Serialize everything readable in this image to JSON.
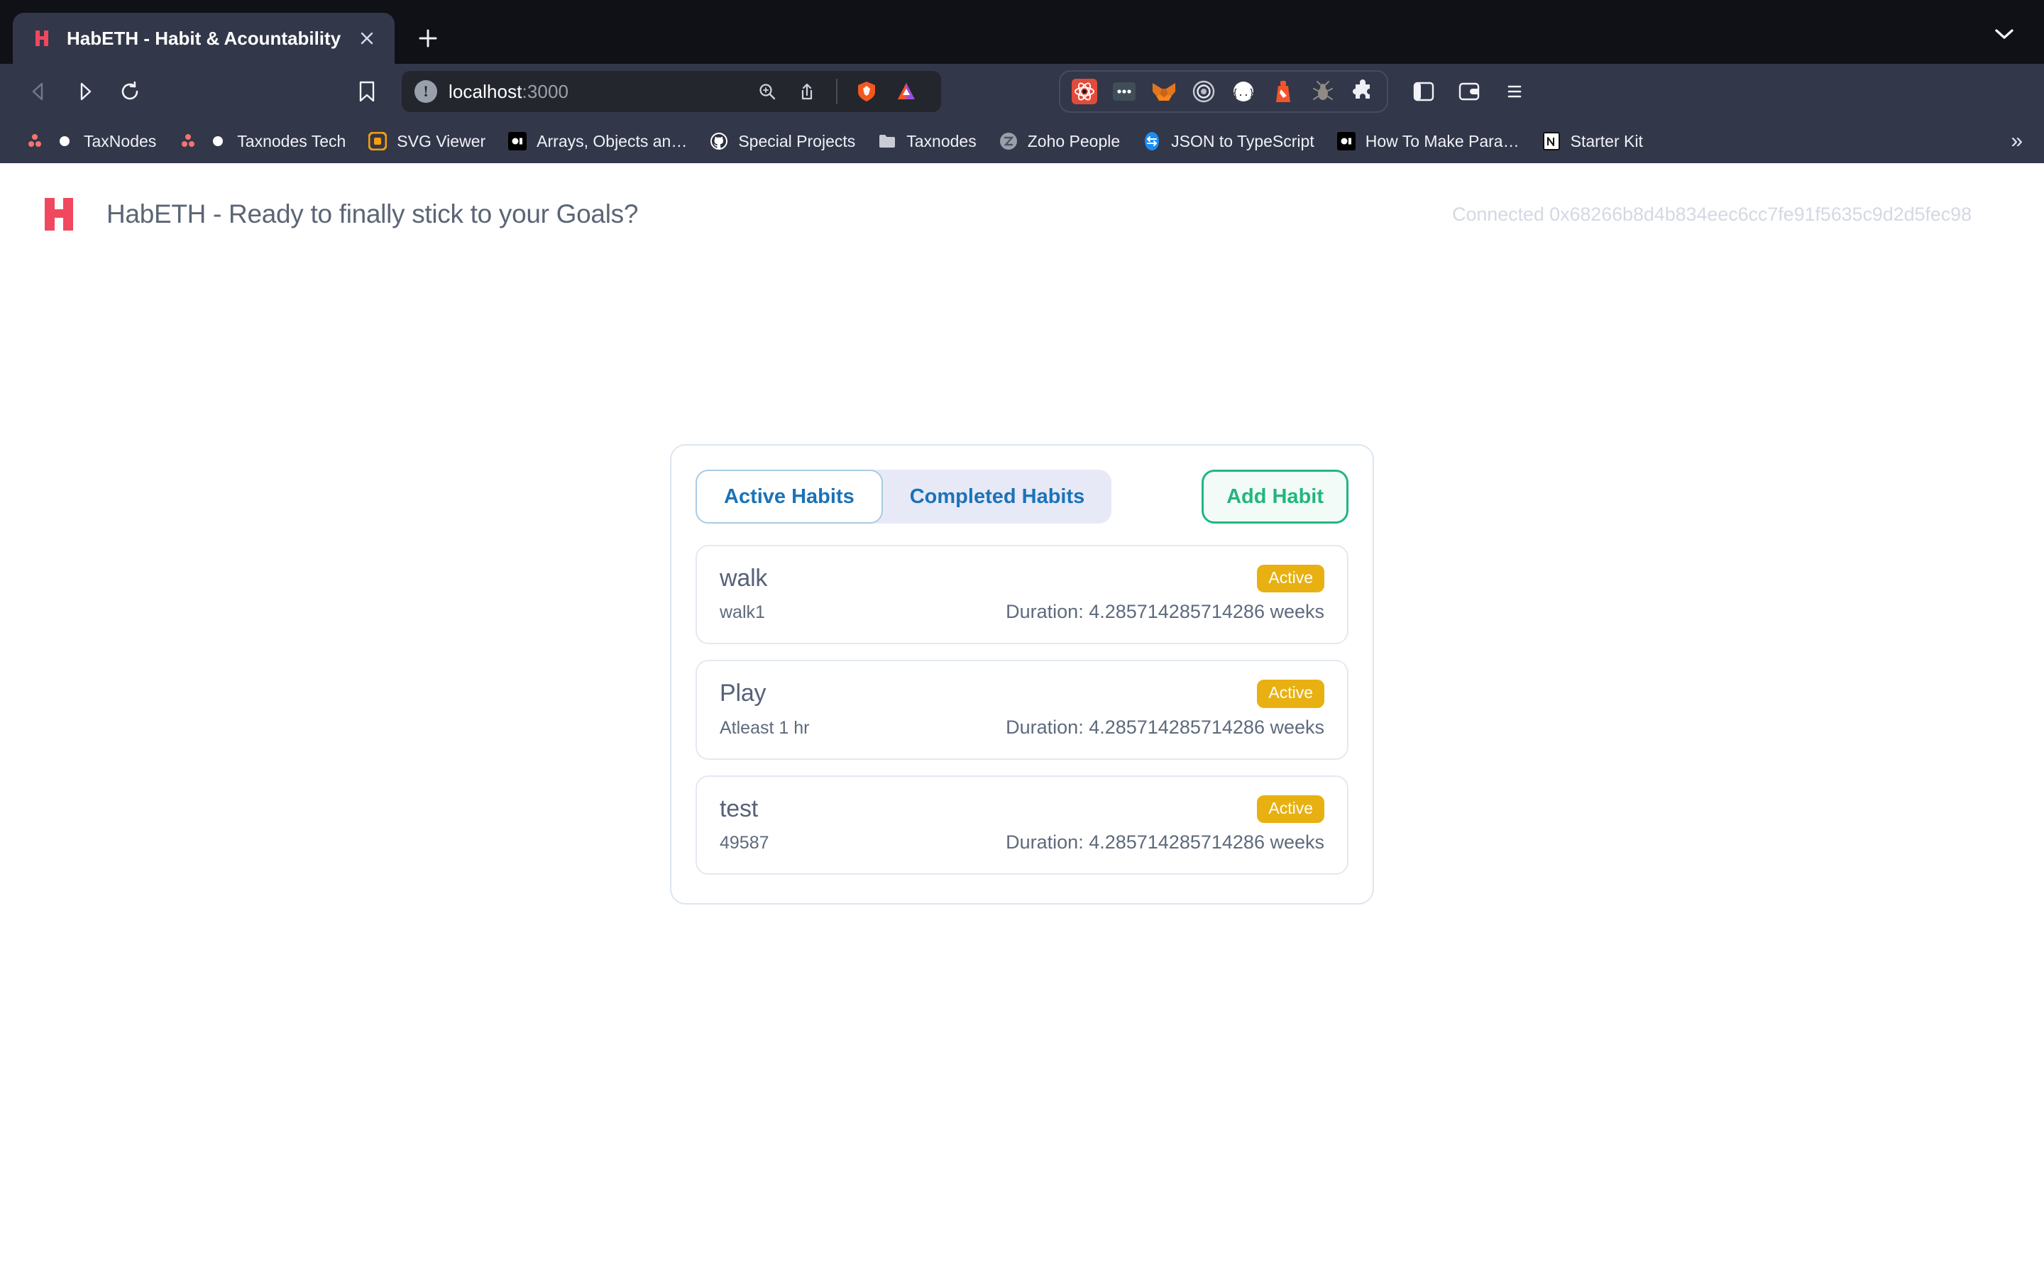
{
  "browser": {
    "tab": {
      "title": "HabETH - Habit & Acountability",
      "close_label": "×",
      "favicon_name": "habeth-favicon"
    },
    "new_tab_label": "+",
    "tab_search_name": "tab-search-chevron",
    "nav": {
      "back_label": "Back",
      "forward_label": "Forward",
      "reload_label": "Reload"
    },
    "url": {
      "host": "localhost",
      "port": ":3000",
      "security_label": "!",
      "security_state": "Not secure"
    },
    "url_actions": [
      "zoom-in-icon",
      "share-icon",
      "brave-shields-icon",
      "bat-rewards-icon"
    ],
    "extensions": [
      {
        "name": "react-devtools-extension",
        "color": "#e24b3a"
      },
      {
        "name": "dots-extension",
        "color": "#3f4e57"
      },
      {
        "name": "metamask-extension",
        "color": "#e2761b"
      },
      {
        "name": "target-extension",
        "color": "#b8bcc4"
      },
      {
        "name": "json-viewer-extension",
        "color": "#ffffff"
      },
      {
        "name": "lighthouse-extension",
        "color": "#f2552c"
      },
      {
        "name": "bug-extension",
        "color": "#8f8a84"
      },
      {
        "name": "puzzle-extension",
        "color": "#eef0f6"
      }
    ],
    "right_icons": [
      "sidebar-icon",
      "wallet-icon",
      "browser-menu-icon"
    ],
    "bookmarks": [
      {
        "label": "TaxNodes",
        "icon": "taxnodes-icon"
      },
      {
        "label": "Taxnodes Tech",
        "icon": "taxnodes-tech-icon"
      },
      {
        "label": "SVG Viewer",
        "icon": "svg-viewer-icon"
      },
      {
        "label": "Arrays, Objects an…",
        "icon": "notion-doc-icon"
      },
      {
        "label": "Special Projects",
        "icon": "github-icon"
      },
      {
        "label": "Taxnodes",
        "icon": "folder-icon"
      },
      {
        "label": "Zoho People",
        "icon": "zoho-icon"
      },
      {
        "label": "JSON to TypeScript",
        "icon": "json-to-ts-icon"
      },
      {
        "label": "How To Make Para…",
        "icon": "notion-doc-icon"
      },
      {
        "label": "Starter Kit",
        "icon": "notion-icon"
      }
    ],
    "bookmarks_overflow_label": "»"
  },
  "app": {
    "logo_name": "habeth-logo",
    "title": "HabETH - Ready to finally stick to your Goals?",
    "wallet_status": "Connected 0x68266b8d4b834eec6cc7fe91f5635c9d2d5fec98",
    "tabs": [
      {
        "label": "Active Habits",
        "selected": true
      },
      {
        "label": "Completed Habits",
        "selected": false
      }
    ],
    "add_habit_label": "Add Habit",
    "habits": [
      {
        "name": "walk",
        "description": "walk1",
        "status": "Active",
        "duration": "Duration: 4.285714285714286 weeks"
      },
      {
        "name": "Play",
        "description": "Atleast 1 hr",
        "status": "Active",
        "duration": "Duration: 4.285714285714286 weeks"
      },
      {
        "name": "test",
        "description": "49587",
        "status": "Active",
        "duration": "Duration: 4.285714285714286 weeks"
      }
    ]
  },
  "colors": {
    "accent_green": "#22b67f",
    "accent_blue": "#1a73b8",
    "badge_amber": "#e8b011",
    "logo_red": "#f0485e",
    "text_slate": "#566278",
    "chrome_bg": "#33374a",
    "tabstrip_bg": "#101116"
  }
}
